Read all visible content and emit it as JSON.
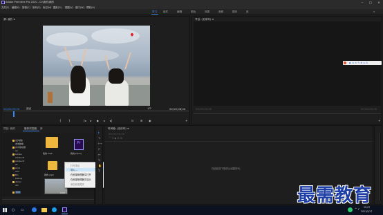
{
  "window": {
    "title": "Adobe Premiere Pro 2020 - D:\\我的\\我的"
  },
  "menu": [
    "文件(F)",
    "编辑(E)",
    "剪辑(C)",
    "序列(S)",
    "标记(M)",
    "图形(G)",
    "视图(V)",
    "窗口(W)",
    "帮助(H)"
  ],
  "workspaces": {
    "items": [
      "学习",
      "组件",
      "编辑",
      "颜色",
      "效果",
      "音频",
      "图形",
      "库"
    ],
    "active": "学习"
  },
  "source": {
    "tab": "源: 我的 ≡",
    "timecode_left": "00;00;00;00",
    "fit": "适合",
    "fraction": "1/2",
    "timecode_right": "00;00;08;00"
  },
  "program": {
    "tab": "节目: (无序列) ≡",
    "timecode_left": "00;00;00;00",
    "timecode_right": "00;00;00;00"
  },
  "project": {
    "tabs": [
      "项目: 我的",
      "媒体浏览器",
      "库"
    ],
    "name_col": "名称",
    "file_label": "我的.mp4",
    "prproj_label": "我的.prproj",
    "video_label": "我的.mp4",
    "video_duration": "8;00",
    "tree": [
      "(此电脑)",
      "本地磁盘",
      "共享驱动器",
      "Ae",
      "Adobe",
      "Adobe Pr",
      "Adobe Pr",
      "AT",
      "Amd",
      "Aris",
      "Bin",
      "Debug",
      "demo",
      "dm",
      "素材"
    ]
  },
  "context_menu": {
    "items": [
      "打开项目",
      "导入...",
      "在资源管理器中打开",
      "在资源管理器中显示",
      "添加到收藏夹"
    ],
    "highlighted": 1
  },
  "timeline": {
    "tab": "时间轴: (无序列) ≡",
    "timecode": "00;00;00;00",
    "drop_hint": "在此处放下媒体以创建序列。"
  },
  "taskbar": {
    "time": "15:07",
    "date": "2021/5/17"
  },
  "watermark": "最需教育"
}
